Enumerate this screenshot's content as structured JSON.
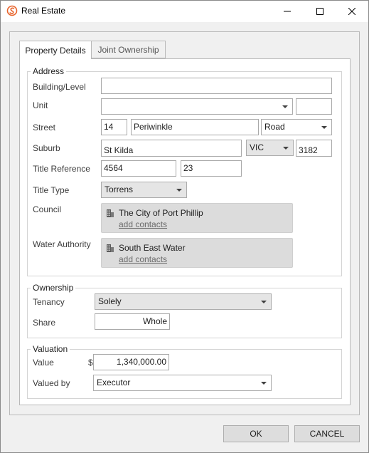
{
  "window": {
    "title": "Real Estate"
  },
  "tabs": [
    {
      "label": "Property Details"
    },
    {
      "label": "Joint Ownership"
    }
  ],
  "address": {
    "legend": "Address",
    "building_label": "Building/Level",
    "building_value": "",
    "unit_label": "Unit",
    "unit_value": "",
    "unit_extra_value": "",
    "street_label": "Street",
    "street_number": "14",
    "street_name": "Periwinkle",
    "street_type": "Road",
    "suburb_label": "Suburb",
    "suburb_value": "St Kilda",
    "state_value": "VIC",
    "postcode_value": "3182",
    "title_ref_label": "Title Reference",
    "title_ref_1": "4564",
    "title_ref_2": "23",
    "title_type_label": "Title Type",
    "title_type_value": "Torrens",
    "council_label": "Council",
    "council_name": "The City of Port Phillip",
    "council_link": "add contacts",
    "water_label": "Water Authority",
    "water_name": "South East Water",
    "water_link": "add contacts"
  },
  "ownership": {
    "legend": "Ownership",
    "tenancy_label": "Tenancy",
    "tenancy_value": "Solely",
    "share_label": "Share",
    "share_value": "Whole"
  },
  "valuation": {
    "legend": "Valuation",
    "value_label": "Value",
    "currency": "$",
    "value": "1,340,000.00",
    "valued_by_label": "Valued by",
    "valued_by_value": "Executor"
  },
  "footer": {
    "ok_label": "OK",
    "cancel_label": "CANCEL"
  },
  "icons": {
    "app": "app-logo-icon",
    "building": "building-icon"
  },
  "colors": {
    "accent": "#e8632b"
  }
}
